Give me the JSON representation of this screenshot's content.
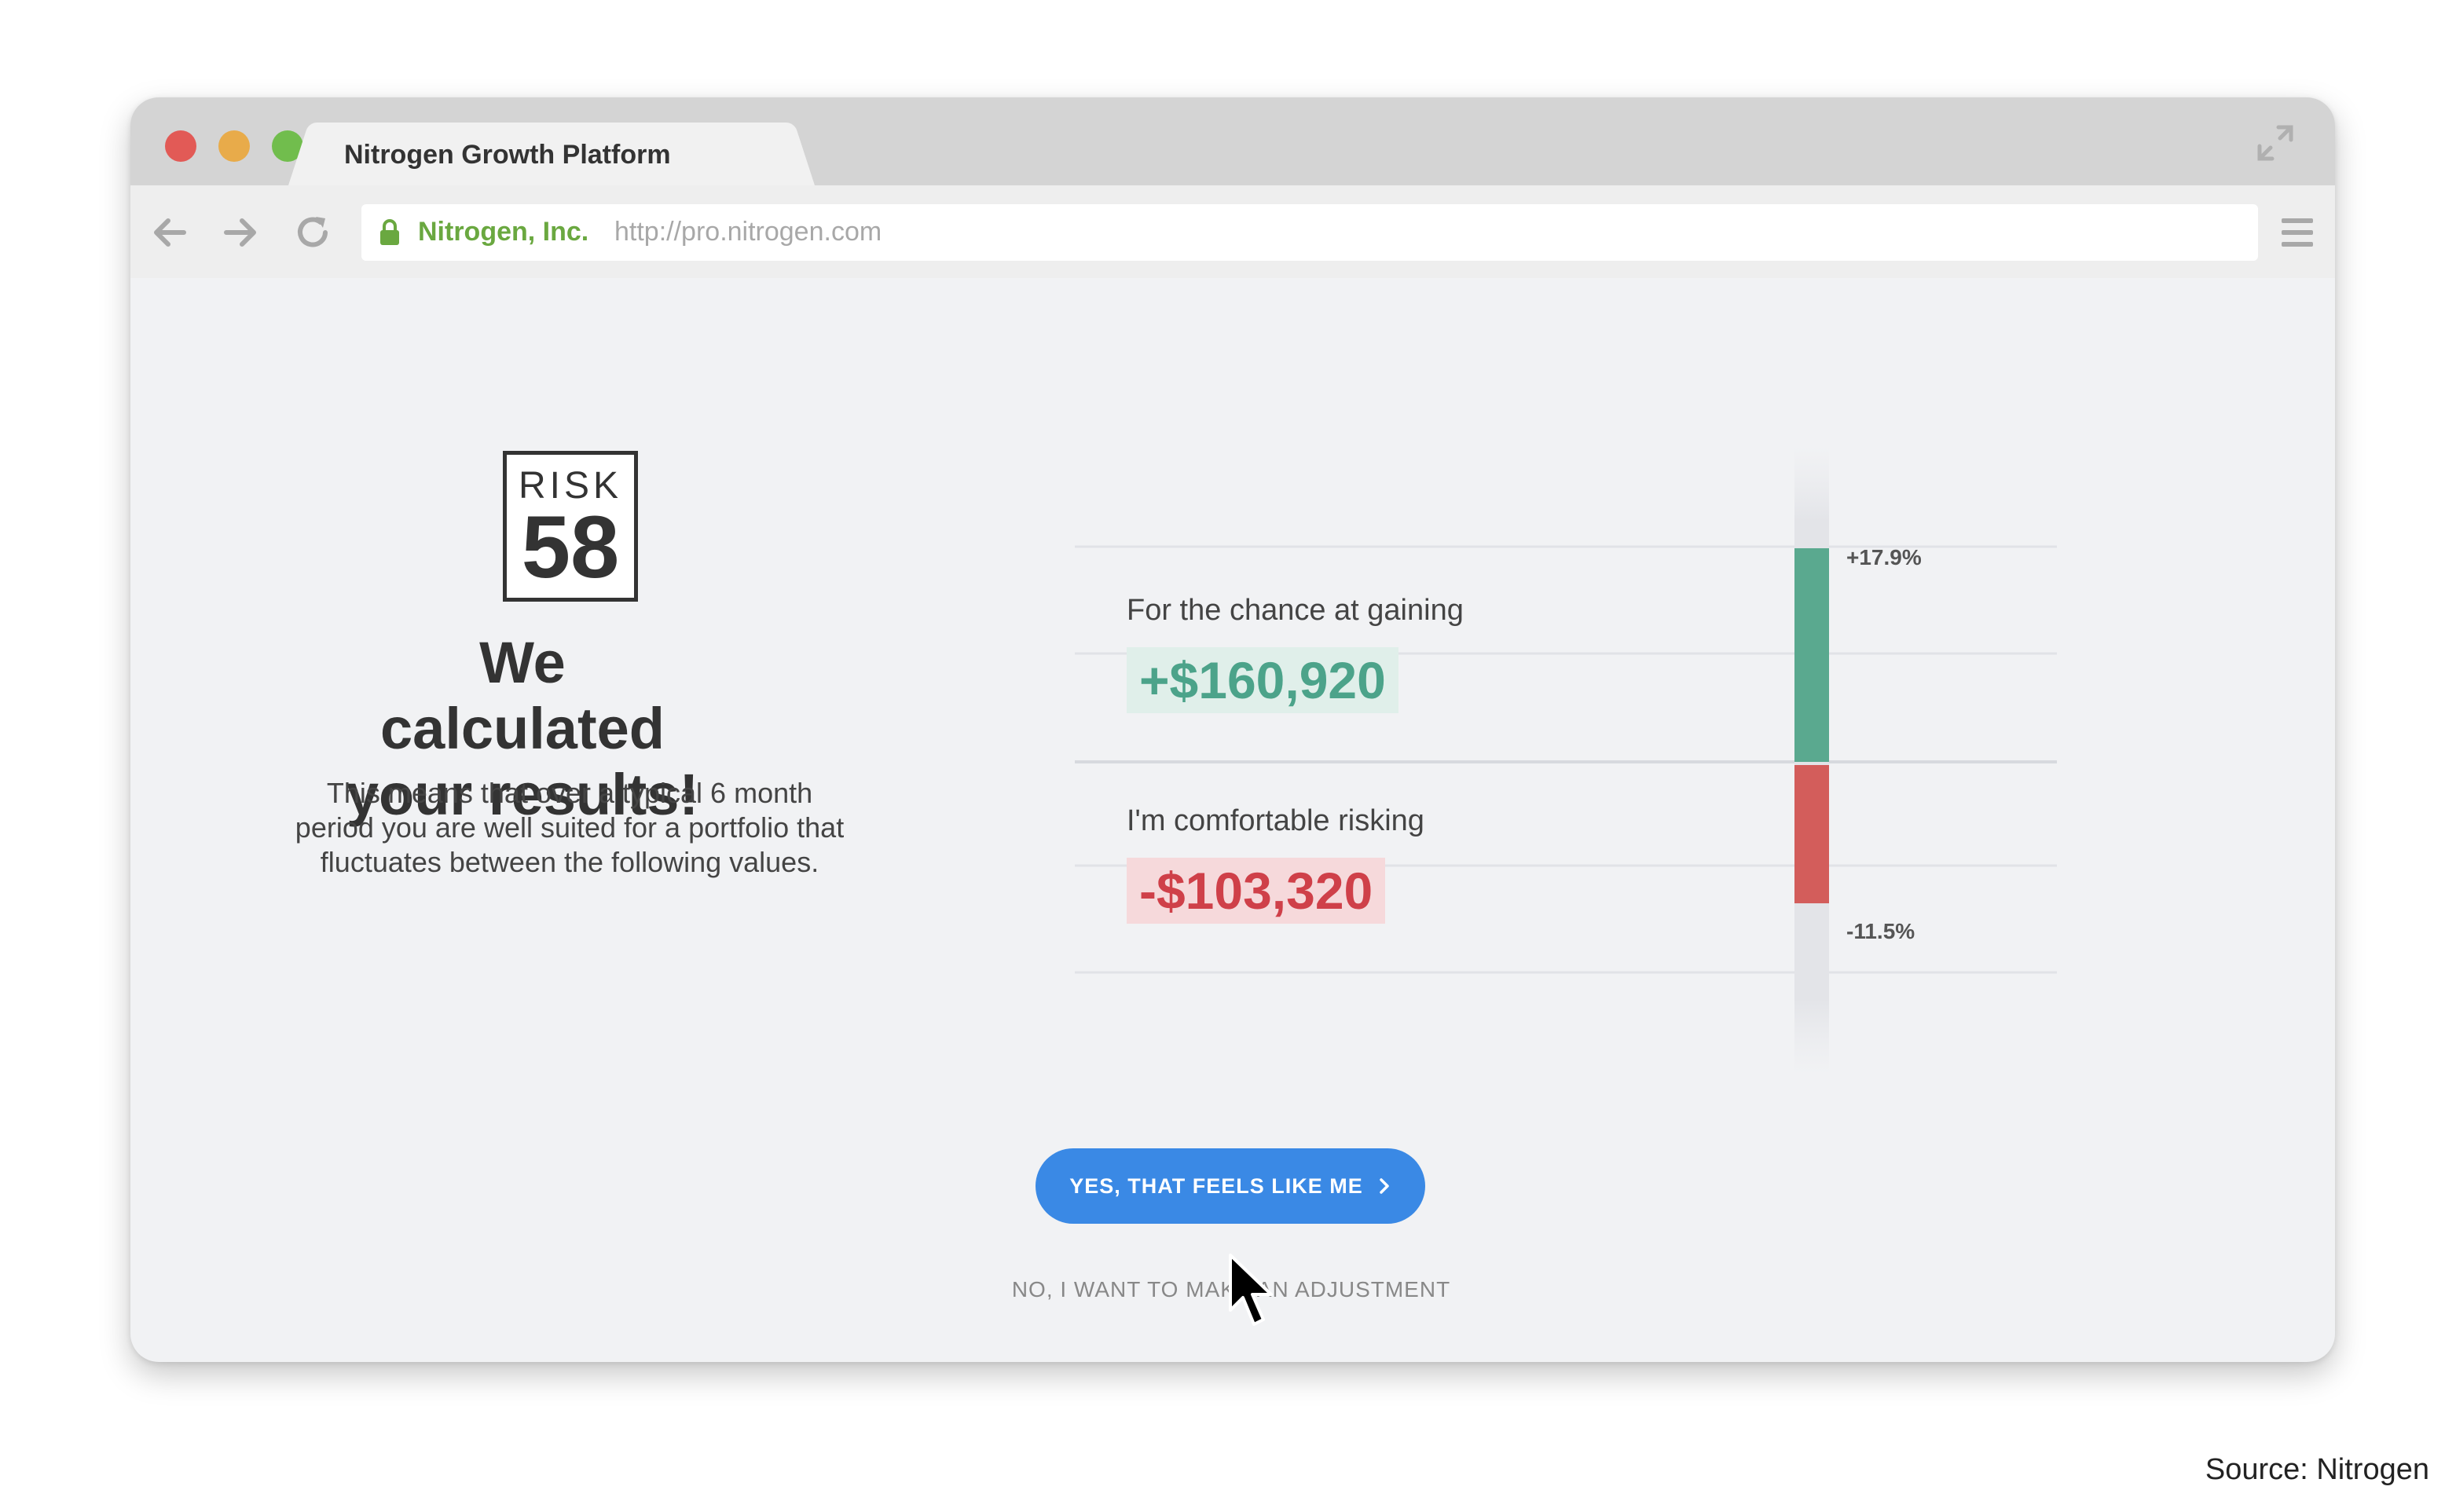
{
  "browser": {
    "tab_title": "Nitrogen Growth Platform",
    "site_name": "Nitrogen, Inc.",
    "url": "http://pro.nitrogen.com",
    "icons": [
      "close-light",
      "minimize-light",
      "zoom-light",
      "back-arrow-icon",
      "forward-arrow-icon",
      "reload-icon",
      "lock-icon",
      "hamburger-menu-icon",
      "expand-icon"
    ]
  },
  "risk": {
    "label": "RISK",
    "score": "58"
  },
  "content": {
    "headline": "We calculated your results!",
    "description": "This means that over a typical 6 month period you are well suited for a portfolio that fluctuates between the following values."
  },
  "chart_data": {
    "type": "bar",
    "gain_label": "For the chance at gaining",
    "gain_value": "+$160,920",
    "gain_percent": 17.9,
    "gain_percent_label": "+17.9%",
    "loss_label": "I'm comfortable risking",
    "loss_value": "-$103,320",
    "loss_percent": -11.5,
    "loss_percent_label": "-11.5%",
    "colors": {
      "gain": "#5aa98f",
      "loss": "#d35d5b"
    }
  },
  "actions": {
    "confirm_label": "YES, THAT FEELS LIKE ME",
    "adjust_label": "NO, I WANT TO MAKE AN ADJUSTMENT"
  },
  "footer": {
    "source": "Source: Nitrogen"
  },
  "colors": {
    "accent": "#3a89e5",
    "site_name": "#6aa840"
  }
}
